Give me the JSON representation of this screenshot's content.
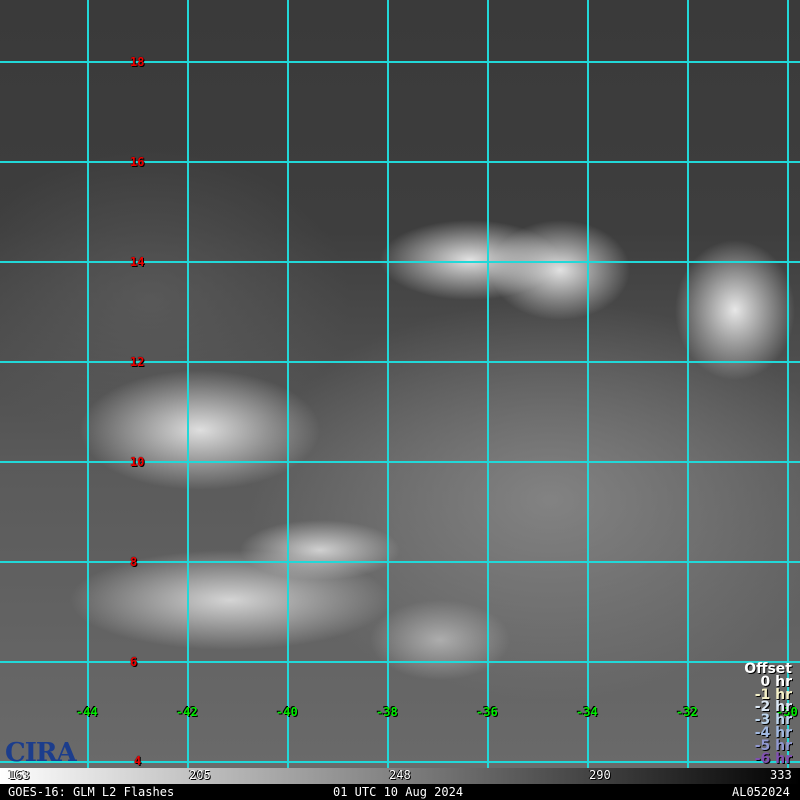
{
  "map": {
    "lat_labels": [
      "18",
      "16",
      "14",
      "12",
      "10",
      "8",
      "6",
      "4"
    ],
    "lon_labels": [
      "-44",
      "-42",
      "-40",
      "-38",
      "-36",
      "-34",
      "-32",
      "-30"
    ]
  },
  "legend": {
    "title": "Offset",
    "items": [
      {
        "label": "0 hr",
        "color": "#ffffff"
      },
      {
        "label": "-1 hr",
        "color": "#f4f0c8"
      },
      {
        "label": "-2 hr",
        "color": "#dce8f4"
      },
      {
        "label": "-3 hr",
        "color": "#bcd4ec"
      },
      {
        "label": "-4 hr",
        "color": "#a0b8e0"
      },
      {
        "label": "-5 hr",
        "color": "#9098d0"
      },
      {
        "label": "-6 hr",
        "color": "#8050b0"
      }
    ]
  },
  "logo": {
    "text": "CIRA"
  },
  "colorbar": {
    "ticks": [
      "163",
      "205",
      "248",
      "290",
      "333"
    ]
  },
  "footer": {
    "product": "GOES-16: GLM L2 Flashes",
    "time": "01 UTC 10 Aug 2024",
    "storm_id": "AL052024"
  }
}
